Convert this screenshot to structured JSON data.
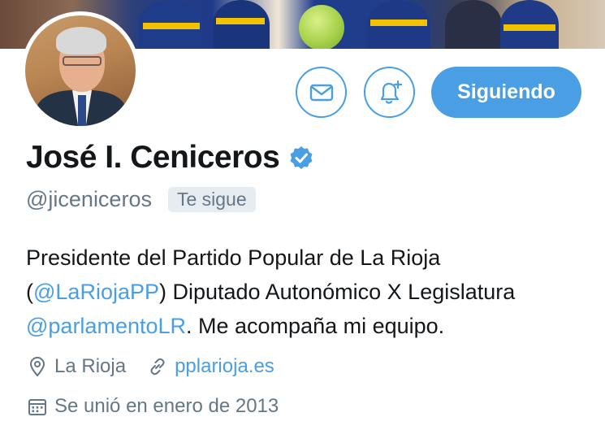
{
  "profile": {
    "name": "José I. Ceniceros",
    "handle": "@jiceniceros",
    "follows_you": "Te sigue",
    "bio_parts": [
      "Presidente del Partido Popular de La Rioja",
      "(",
      "@LaRiojaPP",
      ") Diputado Autonómico X Legislatura",
      "@parlamentoLR",
      ". Me acompaña mi equipo."
    ],
    "location": "La Rioja",
    "website": "pplarioja.es",
    "joined": "Se unió en enero de 2013"
  },
  "actions": {
    "follow_label": "Siguiendo"
  },
  "icons": {
    "message": "envelope-icon",
    "notifications": "bell-plus-icon",
    "verified": "verified-badge-icon",
    "location": "map-pin-icon",
    "link": "link-icon",
    "calendar": "calendar-icon"
  },
  "colors": {
    "accent": "#4a9ee3",
    "secondary_text": "#657786",
    "primary_text": "#14171a",
    "badge_bg": "#e6ecf0"
  }
}
